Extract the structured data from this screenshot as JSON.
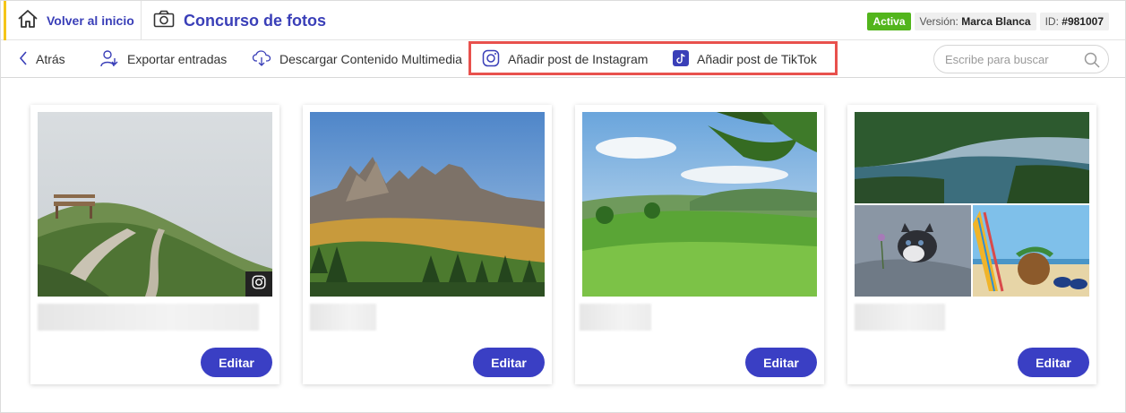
{
  "header": {
    "home_label": "Volver al inicio",
    "title": "Concurso de fotos",
    "status_badge": "Activa",
    "version_label": "Versión:",
    "version_value": "Marca Blanca",
    "id_label": "ID:",
    "id_value": "#981007"
  },
  "toolbar": {
    "back_label": "Atrás",
    "export_label": "Exportar entradas",
    "download_label": "Descargar Contenido Multimedia",
    "add_instagram_label": "Añadir post de Instagram",
    "add_tiktok_label": "Añadir post de TikTok",
    "search_placeholder": "Escribe para buscar",
    "search_value": ""
  },
  "cards": [
    {
      "photo": "foggy mountain trail with bench",
      "source_icon": "instagram-icon",
      "edit_label": "Editar"
    },
    {
      "photo": "rocky mountain peaks over forest",
      "edit_label": "Editar"
    },
    {
      "photo": "green meadow with trees and hills",
      "edit_label": "Editar"
    },
    {
      "photo": "collage: lake, kitten, beach coconut",
      "edit_label": "Editar"
    }
  ],
  "colors": {
    "brand": "#3a3fb8",
    "button": "#3a3fc4",
    "active": "#52b51c",
    "highlight": "#e8514d",
    "accent_strip": "#f5c518"
  }
}
